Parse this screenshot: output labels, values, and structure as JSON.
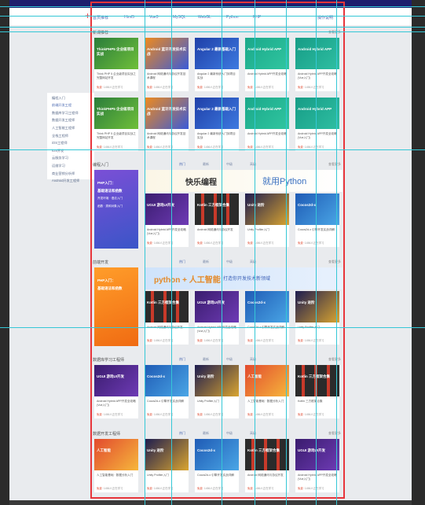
{
  "nav": {
    "items": [
      "首页推荐",
      "Html5",
      "Vue3",
      "MySQL",
      "WebGL",
      "Python",
      "PHP",
      "操作说明"
    ]
  },
  "sidebar": {
    "items": [
      "编程入门",
      "前端开发工程",
      "数据库学习工程师",
      "数据开发工程师",
      "人工智能工程师",
      "全栈工程师",
      "iOS工程师",
      "iOS开发",
      "云服务学习",
      "运维学习",
      "商业营销分析师",
      "Android开发工程师"
    ]
  },
  "sections": [
    {
      "title": "新课推荐",
      "more": "查看更多",
      "tabs": [],
      "cards": [
        {
          "thumb": "ThinkPHP5 企业级项目实战",
          "title": "Think PHP 5 企业级项目实战之完整网站开发",
          "meta_tag": "免费",
          "meta": "· 1456人正在学习"
        },
        {
          "thumb": "Android 蓝牙开发技术实战",
          "title": "Android 网络通讯与协议开发技术课程",
          "meta_tag": "免费",
          "meta": "· 1456人正在学习"
        },
        {
          "thumb": "Angular 2 最新基础入门",
          "title": "Angular 2 最新系统入门到项目实战",
          "meta_tag": "免费",
          "meta": "· 1456人正在学习"
        },
        {
          "thumb": "Android Hybrid APP",
          "title": "Android Hybrid APP开发全攻略",
          "meta_tag": "免费",
          "meta": "· 1456人正在学习"
        },
        {
          "thumb": "Android Hybrid APP",
          "title": "Android Hybrid APP开发全攻略 (Vue入门)",
          "meta_tag": "免费",
          "meta": "· 1456人正在学习"
        },
        {
          "thumb": "ThinkPHP5 企业级项目实战",
          "title": "Think PHP 5 企业级项目实战之完整网站开发",
          "meta_tag": "免费",
          "meta": "· 1456人正在学习"
        },
        {
          "thumb": "Android 蓝牙开发技术实战",
          "title": "Android 网络通讯与协议开发技术课程",
          "meta_tag": "免费",
          "meta": "· 1456人正在学习"
        },
        {
          "thumb": "Angular 2 最新基础入门",
          "title": "Angular 2 最新系统入门到项目实战",
          "meta_tag": "免费",
          "meta": "· 1456人正在学习"
        },
        {
          "thumb": "Android Hybrid APP",
          "title": "Android Hybrid APP开发全攻略",
          "meta_tag": "免费",
          "meta": "· 1456人正在学习"
        },
        {
          "thumb": "Android Hybrid APP",
          "title": "Android Hybrid APP开发全攻略 (Vue入门)",
          "meta_tag": "免费",
          "meta": "· 1456人正在学习"
        }
      ]
    },
    {
      "title": "编程入门",
      "more": "查看更多",
      "tabs": [
        "热门",
        "最新",
        "中级",
        "高级"
      ],
      "promo": [
        "PHP入门：",
        "基础语法和函数",
        "开发环境 · 语法入门",
        "函数 · 类和对象入门"
      ],
      "banner1": "快乐编程",
      "banner2": "就用Python",
      "cards": [
        {
          "thumb": "UGUI 游戏UI开发",
          "title": "Android Hybrid APP开发全攻略 (Vue入门)",
          "meta_tag": "免费",
          "meta": "· 1456人正在学习"
        },
        {
          "thumb": "Kotlin 三方框架合集",
          "title": "Android 网络通讯与协议开发",
          "meta_tag": "免费",
          "meta": "· 1456人正在学习"
        },
        {
          "thumb": "Unity 进阶",
          "title": "Unity Profiler入门",
          "meta_tag": "免费",
          "meta": "· 1456人正在学习"
        },
        {
          "thumb": "Cocos2d-x",
          "title": "Cocos2d-x 引擎开发实战详解",
          "meta_tag": "免费",
          "meta": "· 1456人正在学习"
        }
      ]
    },
    {
      "title": "前端开发",
      "more": "查看更多",
      "tabs": [
        "热门",
        "最新",
        "中级",
        "高级"
      ],
      "promo": [
        "PHP入门：",
        "基础语法和函数"
      ],
      "banner1": "python + 人工智能",
      "banner2": "打造你开发技术新领域",
      "cards": [
        {
          "thumb": "Kotlin 三方框架合集",
          "title": "Android 网络通讯与协议开发",
          "meta_tag": "免费",
          "meta": "· 1456人正在学习"
        },
        {
          "thumb": "UGUI 游戏UI开发",
          "title": "Android Hybrid APP开发全攻略 (Vue入门)",
          "meta_tag": "免费",
          "meta": "· 1456人正在学习"
        },
        {
          "thumb": "Cocos2d-x",
          "title": "Cocos2d-x 引擎开发实战详解",
          "meta_tag": "免费",
          "meta": "· 1456人正在学习"
        },
        {
          "thumb": "Unity 进阶",
          "title": "Unity Profiler入门",
          "meta_tag": "免费",
          "meta": "· 1456人正在学习"
        }
      ]
    },
    {
      "title": "数据库学习工程师",
      "more": "查看更多",
      "tabs": [
        "热门",
        "最新",
        "中级",
        "高级"
      ],
      "cards": [
        {
          "thumb": "UGUI 游戏UI开发",
          "title": "Android Hybrid APP开发全攻略 (Vue入门)",
          "meta_tag": "免费",
          "meta": "· 1456人正在学习"
        },
        {
          "thumb": "Cocos2d-x",
          "title": "Cocos2d-x 引擎开发实战详解",
          "meta_tag": "免费",
          "meta": "· 1456人正在学习"
        },
        {
          "thumb": "Unity 进阶",
          "title": "Unity Profiler入门",
          "meta_tag": "免费",
          "meta": "· 1456人正在学习"
        },
        {
          "thumb": "人工智能",
          "title": "人工智能基础 · 数据分析入门",
          "meta_tag": "免费",
          "meta": "· 1456人正在学习"
        },
        {
          "thumb": "Kotlin 三方框架合集",
          "title": "Kotlin 三方框架合集",
          "meta_tag": "免费",
          "meta": "· 1456人正在学习"
        }
      ]
    },
    {
      "title": "数据开发工程师",
      "more": "查看更多",
      "tabs": [
        "热门",
        "最新",
        "中级",
        "高级"
      ],
      "cards": [
        {
          "thumb": "人工智能",
          "title": "人工智能基础 · 数据分析入门",
          "meta_tag": "免费",
          "meta": "· 1456人正在学习"
        },
        {
          "thumb": "Unity 进阶",
          "title": "Unity Profiler入门",
          "meta_tag": "免费",
          "meta": "· 1456人正在学习"
        },
        {
          "thumb": "Cocos2d-x",
          "title": "Cocos2d-x 引擎开发实战详解",
          "meta_tag": "免费",
          "meta": "· 1456人正在学习"
        },
        {
          "thumb": "Kotlin 三方框架合集",
          "title": "Android 网络通讯与协议开发",
          "meta_tag": "免费",
          "meta": "· 1456人正在学习"
        },
        {
          "thumb": "UGUI 游戏UI开发",
          "title": "Android Hybrid APP开发全攻略 (Vue入门)",
          "meta_tag": "免费",
          "meta": "· 1456人正在学习"
        }
      ]
    }
  ],
  "colors": {
    "topbar": "#1e1d6d",
    "accent": "#4d6bb2",
    "guides": "#35c7d6",
    "selection": "#e8353b",
    "price_tag": "#e04c33"
  }
}
